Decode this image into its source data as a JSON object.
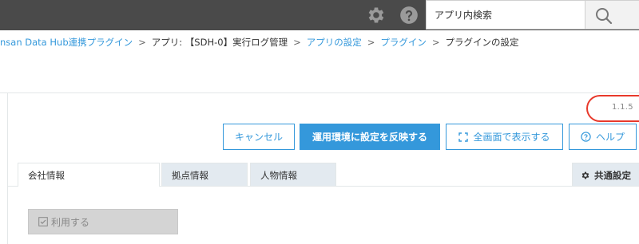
{
  "header": {
    "icons": [
      "gear-icon",
      "help-icon"
    ],
    "search": {
      "placeholder": "アプリ内検索",
      "value": ""
    },
    "search_button_icon": "search-icon"
  },
  "breadcrumb": [
    {
      "label": "nsan Data Hub連携プラグイン",
      "link": true
    },
    {
      "label": "アプリ: 【SDH-0】実行ログ管理",
      "link": false
    },
    {
      "label": "アプリの設定",
      "link": true
    },
    {
      "label": "プラグイン",
      "link": true
    },
    {
      "label": "プラグインの設定",
      "link": false
    }
  ],
  "breadcrumb_separator": ">",
  "plugin": {
    "version": "1.1.5"
  },
  "toolbar": {
    "cancel_label": "キャンセル",
    "apply_label": "運用環境に設定を反映する",
    "fullscreen_label": "全画面で表示する",
    "help_label": "ヘルプ"
  },
  "tabs": [
    {
      "label": "会社情報",
      "active": true
    },
    {
      "label": "拠点情報",
      "active": false
    },
    {
      "label": "人物情報",
      "active": false
    }
  ],
  "common_settings_tab": {
    "label": "共通設定",
    "icon": "gear-icon"
  },
  "use_toggle": {
    "label": "利用する",
    "checked": false,
    "icon": "checkbox-icon"
  },
  "colors": {
    "header_bg": "#4a4a4a",
    "accent": "#3498db",
    "highlight_circle": "#e8392b",
    "tab_inactive_bg": "#e3eaf0"
  }
}
